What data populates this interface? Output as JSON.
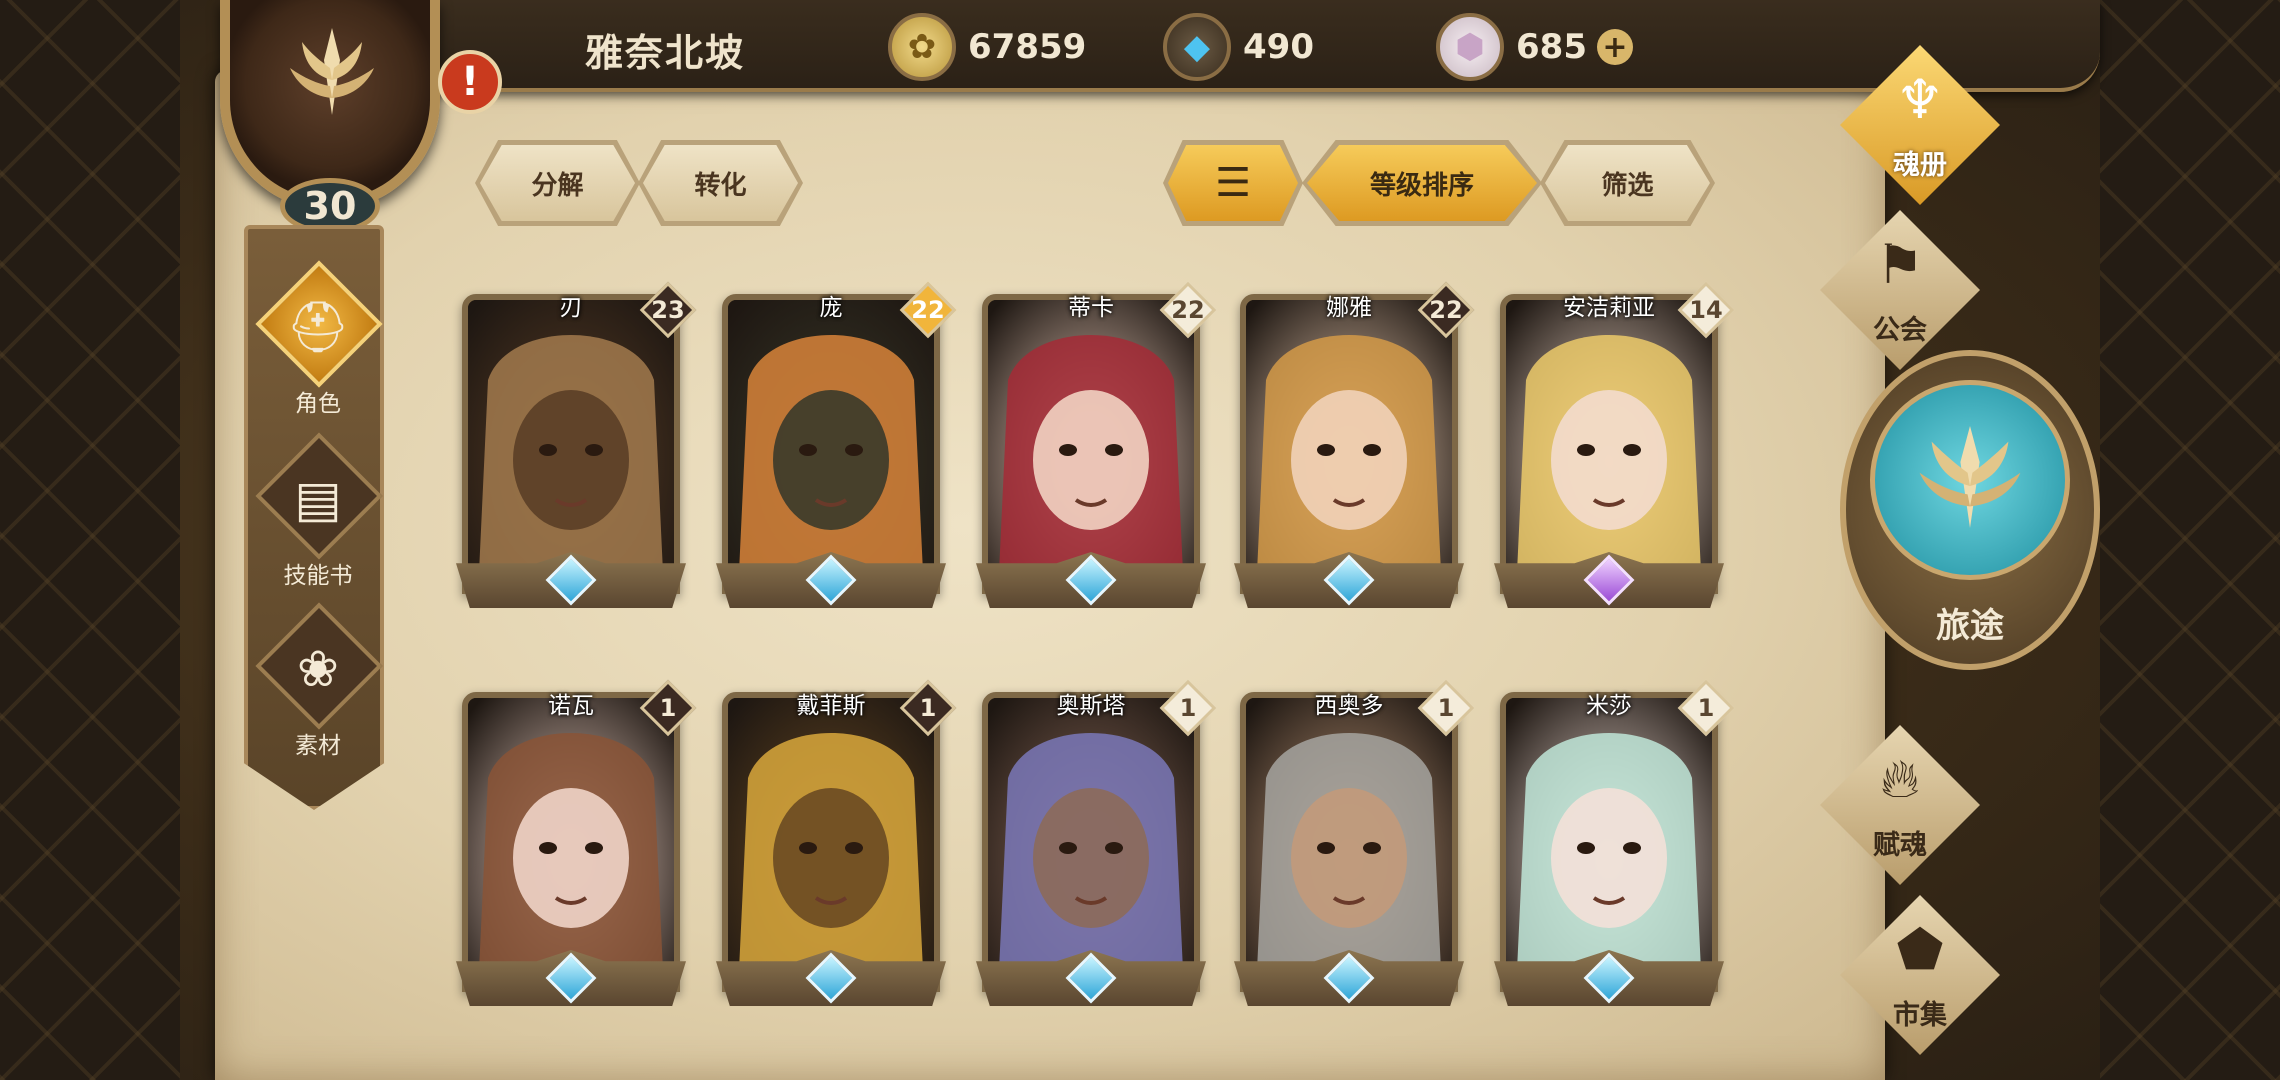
{
  "header": {
    "player_name": "雅奈北坡",
    "level": "30",
    "alert": "!",
    "resources": [
      {
        "icon": "gold-coin-icon",
        "value": "67859"
      },
      {
        "icon": "blue-crystal-icon",
        "value": "490"
      },
      {
        "icon": "pink-gem-icon",
        "value": "685",
        "plus": "+"
      }
    ]
  },
  "left_nav": [
    {
      "label": "角色",
      "icon": "helmet-icon",
      "active": true
    },
    {
      "label": "技能书",
      "icon": "skill-book-icon",
      "active": false
    },
    {
      "label": "素材",
      "icon": "material-beast-icon",
      "active": false
    }
  ],
  "toolbar": {
    "decompose": "分解",
    "convert": "转化",
    "sort_icon": "sort-lines-icon",
    "sort_by_level": "等级排序",
    "filter": "筛选"
  },
  "cards": [
    {
      "name": "刃",
      "level": "23",
      "badge": "dark",
      "gem": "blue",
      "portrait": "bear"
    },
    {
      "name": "庞",
      "level": "22",
      "badge": "gold",
      "gem": "blue",
      "portrait": "tiger"
    },
    {
      "name": "蒂卡",
      "level": "22",
      "badge": "light",
      "gem": "blue",
      "portrait": "red-hair-girl"
    },
    {
      "name": "娜雅",
      "level": "22",
      "badge": "dark",
      "gem": "blue",
      "portrait": "blonde-boy"
    },
    {
      "name": "安洁莉亚",
      "level": "14",
      "badge": "light",
      "gem": "purple",
      "portrait": "blonde-girl"
    },
    {
      "name": "诺瓦",
      "level": "1",
      "badge": "dark",
      "gem": "blue",
      "portrait": "brown-hair-girl"
    },
    {
      "name": "戴菲斯",
      "level": "1",
      "badge": "dark",
      "gem": "blue",
      "portrait": "golden-serpent"
    },
    {
      "name": "奥斯塔",
      "level": "1",
      "badge": "light",
      "gem": "blue",
      "portrait": "purple-hair-man"
    },
    {
      "name": "西奥多",
      "level": "1",
      "badge": "light",
      "gem": "blue",
      "portrait": "grey-hair-man"
    },
    {
      "name": "米莎",
      "level": "1",
      "badge": "light",
      "gem": "blue",
      "portrait": "mint-hair-girl"
    }
  ],
  "right_nav": [
    {
      "label": "魂册",
      "icon": "soul-book-icon",
      "active": true
    },
    {
      "label": "公会",
      "icon": "guild-banner-icon",
      "active": false
    },
    {
      "label": "旅途",
      "icon": "journey-emblem-icon",
      "active": false
    },
    {
      "label": "赋魂",
      "icon": "flame-swirl-icon",
      "active": false
    },
    {
      "label": "市集",
      "icon": "market-gem-icon",
      "active": false
    }
  ],
  "colors": {
    "parchment": "#e8dab8",
    "gold_accent": "#f1b53b",
    "teal": "#2fa6d8",
    "dark_wood": "#2b2116"
  }
}
